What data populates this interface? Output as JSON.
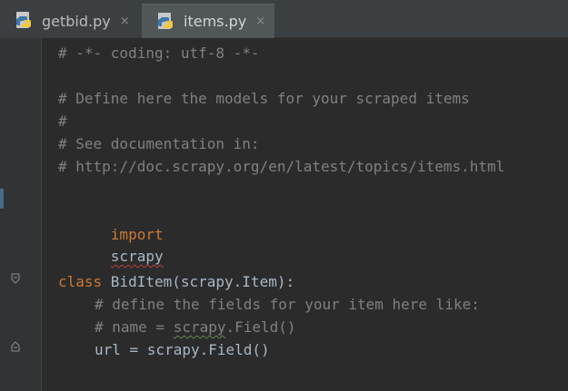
{
  "tabs": [
    {
      "label": "getbid.py",
      "close": "×",
      "active": false
    },
    {
      "label": "items.py",
      "close": "×",
      "active": true
    }
  ],
  "code": {
    "line1": "# -*- coding: utf-8 -*-",
    "line3": "# Define here the models for your scraped items",
    "line4": "#",
    "line5": "# See documentation in:",
    "line6": "# http://doc.scrapy.org/en/latest/topics/items.html",
    "line8_kw": "import",
    "line8_mod": "scrapy",
    "line11_kw": "class",
    "line11_rest": " BidItem(scrapy.Item):",
    "line12": "# define the fields for your item here like:",
    "line13_a": "# name = ",
    "line13_b": "scrapy",
    "line13_c": ".Field()",
    "line14": "url = scrapy.Field()"
  },
  "colors": {
    "background": "#2b2b2b",
    "comment": "#808080",
    "keyword": "#cc7832",
    "text": "#a9b7c6",
    "tabbar": "#3c3f41",
    "active_tab": "#515658"
  }
}
